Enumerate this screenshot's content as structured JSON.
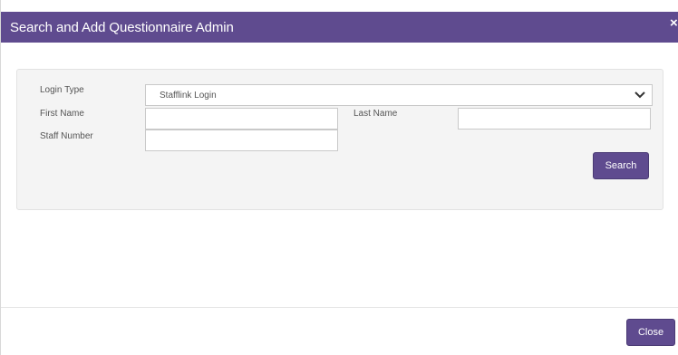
{
  "dialog": {
    "title": "Search and Add Questionnaire Admin",
    "close_glyph": "×"
  },
  "form": {
    "login_type_label": "Login Type",
    "login_type_value": "Stafflink Login",
    "first_name_label": "First Name",
    "first_name_value": "",
    "last_name_label": "Last Name",
    "last_name_value": "",
    "staff_number_label": "Staff Number",
    "staff_number_value": "",
    "search_label": "Search"
  },
  "footer": {
    "close_label": "Close"
  },
  "colors": {
    "header": "#5f4b8f",
    "button": "#5f4b8f",
    "panel": "#f4f4f4"
  },
  "icons": {
    "dropdown": "chevron-down-icon",
    "close": "close-icon"
  }
}
